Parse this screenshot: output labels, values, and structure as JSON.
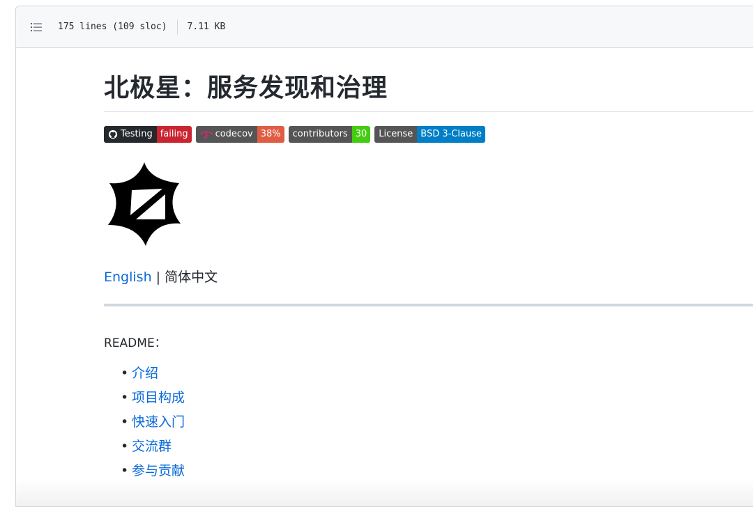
{
  "file_header": {
    "lines_info": "175 lines (109 sloc)",
    "size": "7.11 KB"
  },
  "markdown": {
    "title": "北极星：服务发现和治理",
    "badges": [
      {
        "left": "Testing",
        "right": "failing",
        "right_color": "#cb2431"
      },
      {
        "left": "codecov",
        "right": "38%",
        "right_color": "#e05d44"
      },
      {
        "left": "contributors",
        "right": "30",
        "right_color": "#44cc11"
      },
      {
        "left": "License",
        "right": "BSD 3-Clause",
        "right_color": "#007ec6"
      }
    ],
    "lang_link": "English",
    "lang_sep": " | ",
    "lang_current": "简体中文",
    "readme_label": "README：",
    "toc": [
      {
        "label": "介绍"
      },
      {
        "label": "项目构成"
      },
      {
        "label": "快速入门"
      },
      {
        "label": "交流群"
      },
      {
        "label": "参与贡献"
      }
    ]
  },
  "icons": {
    "list": "list-unordered-icon",
    "github": "github-icon",
    "codecov": "codecov-umbrella-icon",
    "logo": "polaris-star-logo"
  }
}
